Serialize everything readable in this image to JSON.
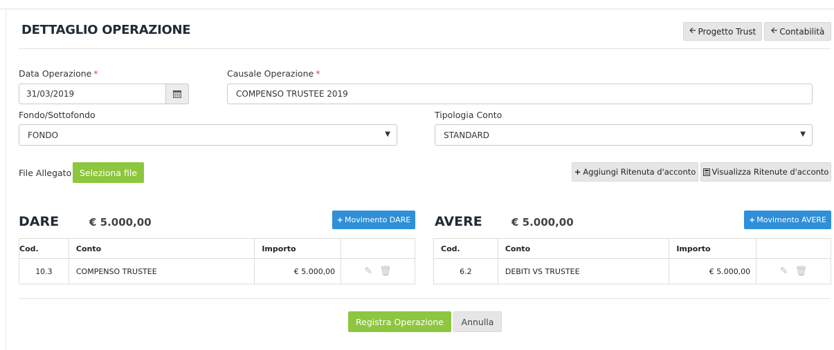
{
  "page": {
    "title": "DETTAGLIO OPERAZIONE"
  },
  "header_buttons": {
    "progetto_trust": "Progetto Trust",
    "contabilita": "Contabilità"
  },
  "form": {
    "data_operazione": {
      "label": "Data Operazione",
      "required_mark": "*",
      "value": "31/03/2019"
    },
    "causale_operazione": {
      "label": "Causale Operazione",
      "required_mark": "*",
      "value": "COMPENSO TRUSTEE 2019"
    },
    "fondo": {
      "label": "Fondo/Sottofondo",
      "value": "FONDO"
    },
    "tipologia_conto": {
      "label": "Tipologia Conto",
      "value": "STANDARD"
    },
    "file": {
      "label": "File Allegato",
      "button": "Seleziona file"
    }
  },
  "ritenute": {
    "add": "Aggiungi Ritenuta d'acconto",
    "view": "Visualizza Ritenute d'acconto"
  },
  "dare": {
    "title": "DARE",
    "total": "€ 5.000,00",
    "add_button": "Movimento DARE",
    "columns": [
      "Cod.",
      "Conto",
      "Importo"
    ],
    "rows": [
      {
        "cod": "10.3",
        "conto": "COMPENSO TRUSTEE",
        "importo": "€ 5.000,00"
      }
    ]
  },
  "avere": {
    "title": "AVERE",
    "total": "€ 5.000,00",
    "add_button": "Movimento AVERE",
    "columns": [
      "Cod.",
      "Conto",
      "Importo"
    ],
    "rows": [
      {
        "cod": "6.2",
        "conto": "DEBITI VS TRUSTEE",
        "importo": "€ 5.000,00"
      }
    ]
  },
  "footer": {
    "submit": "Registra Operazione",
    "cancel": "Annulla"
  },
  "icons": {
    "back": "arrow-left-icon",
    "calendar": "calendar-icon",
    "plus": "plus-icon",
    "calculator": "calculator-icon",
    "edit": "pencil-icon",
    "delete": "trash-icon",
    "dropdown": "caret-down-icon"
  },
  "colors": {
    "green": "#8dc63f",
    "blue": "#2f8fd8",
    "grey_button": "#e6e6e6",
    "required": "#e04646"
  }
}
